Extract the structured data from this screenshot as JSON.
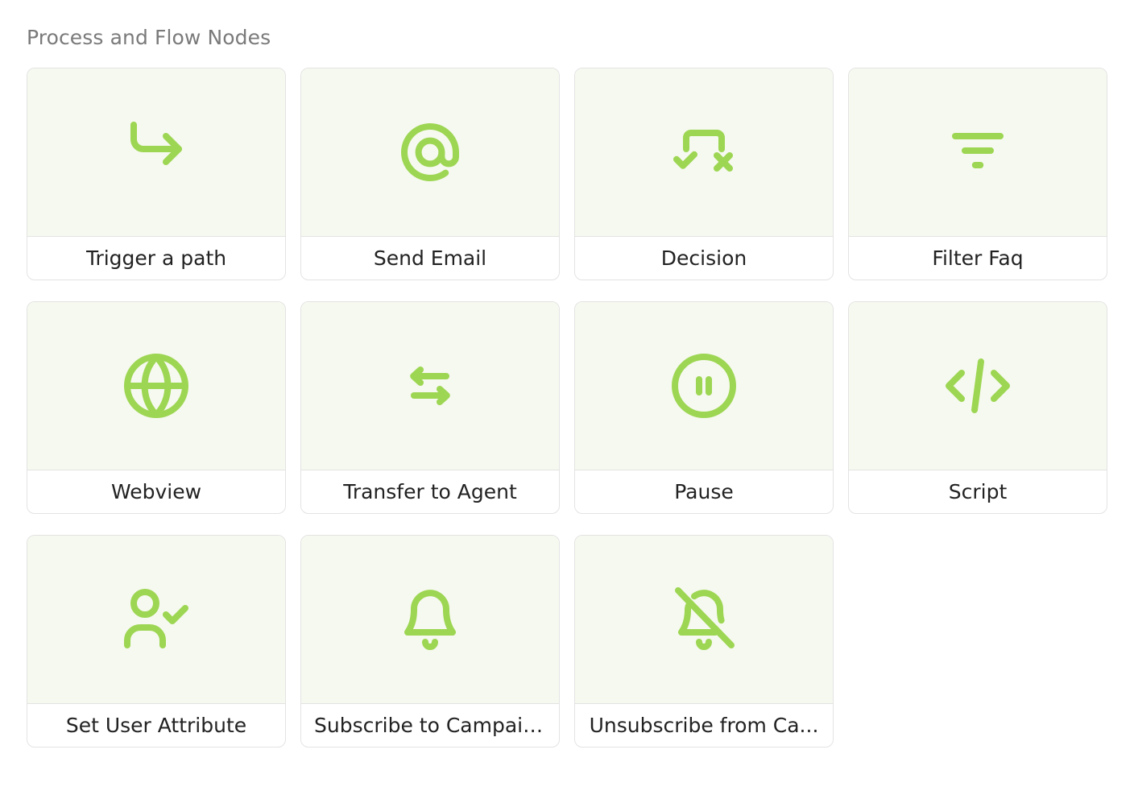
{
  "section": {
    "title": "Process and Flow Nodes"
  },
  "accent_color": "#9dd653",
  "nodes": [
    {
      "label": "Trigger a path",
      "icon": "corner-down-right-arrow-icon"
    },
    {
      "label": "Send Email",
      "icon": "at-sign-icon"
    },
    {
      "label": "Decision",
      "icon": "check-x-decision-icon"
    },
    {
      "label": "Filter Faq",
      "icon": "filter-lines-icon"
    },
    {
      "label": "Webview",
      "icon": "globe-icon"
    },
    {
      "label": "Transfer to Agent",
      "icon": "transfer-arrows-icon"
    },
    {
      "label": "Pause",
      "icon": "pause-circle-icon"
    },
    {
      "label": "Script",
      "icon": "code-icon"
    },
    {
      "label": "Set User Attribute",
      "icon": "user-check-icon"
    },
    {
      "label": "Subscribe to Campaign",
      "icon": "bell-icon"
    },
    {
      "label": "Unsubscribe from Ca...",
      "icon": "bell-off-icon"
    }
  ]
}
